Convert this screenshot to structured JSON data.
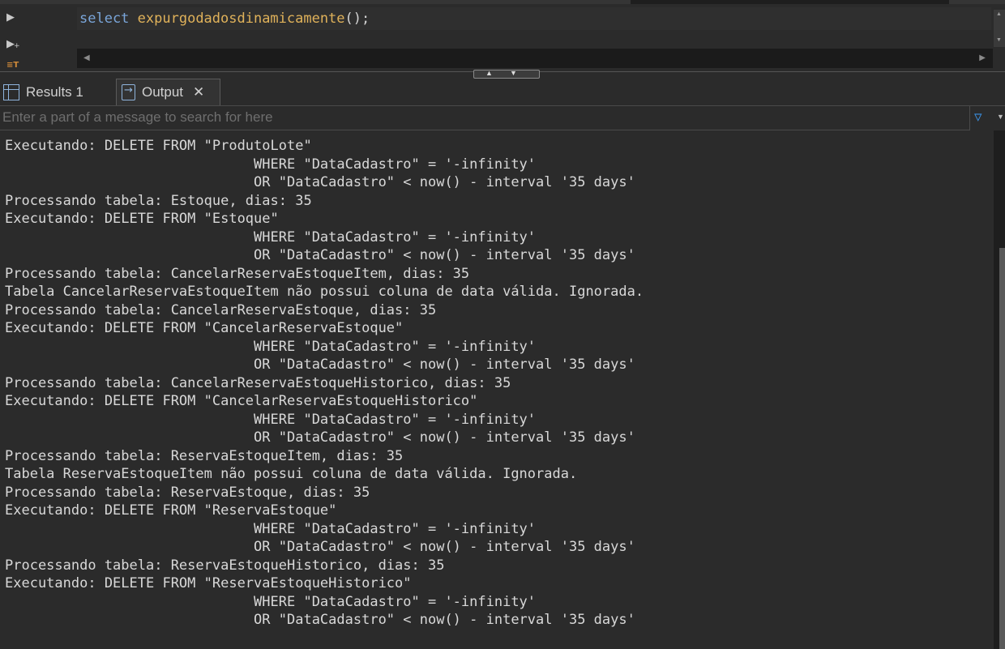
{
  "editor": {
    "code": {
      "keyword": "select",
      "function": "expurgodadosdinamicamente",
      "punct": "();"
    },
    "icons": {
      "run": "play-icon",
      "run_all": "run-script-icon",
      "explain": "explain-plan-icon"
    }
  },
  "tabs": [
    {
      "label": "Results 1",
      "icon": "grid-icon"
    },
    {
      "label": "Output",
      "icon": "output-icon"
    }
  ],
  "search": {
    "placeholder": "Enter a part of a message to search for here",
    "value": ""
  },
  "output": {
    "lines": [
      "Executando: DELETE FROM \"ProdutoLote\"",
      "                              WHERE \"DataCadastro\" = '-infinity'",
      "                              OR \"DataCadastro\" < now() - interval '35 days'",
      "Processando tabela: Estoque, dias: 35",
      "Executando: DELETE FROM \"Estoque\"",
      "                              WHERE \"DataCadastro\" = '-infinity'",
      "                              OR \"DataCadastro\" < now() - interval '35 days'",
      "Processando tabela: CancelarReservaEstoqueItem, dias: 35",
      "Tabela CancelarReservaEstoqueItem não possui coluna de data válida. Ignorada.",
      "Processando tabela: CancelarReservaEstoque, dias: 35",
      "Executando: DELETE FROM \"CancelarReservaEstoque\"",
      "                              WHERE \"DataCadastro\" = '-infinity'",
      "                              OR \"DataCadastro\" < now() - interval '35 days'",
      "Processando tabela: CancelarReservaEstoqueHistorico, dias: 35",
      "Executando: DELETE FROM \"CancelarReservaEstoqueHistorico\"",
      "                              WHERE \"DataCadastro\" = '-infinity'",
      "                              OR \"DataCadastro\" < now() - interval '35 days'",
      "Processando tabela: ReservaEstoqueItem, dias: 35",
      "Tabela ReservaEstoqueItem não possui coluna de data válida. Ignorada.",
      "Processando tabela: ReservaEstoque, dias: 35",
      "Executando: DELETE FROM \"ReservaEstoque\"",
      "                              WHERE \"DataCadastro\" = '-infinity'",
      "                              OR \"DataCadastro\" < now() - interval '35 days'",
      "Processando tabela: ReservaEstoqueHistorico, dias: 35",
      "Executando: DELETE FROM \"ReservaEstoqueHistorico\"",
      "                              WHERE \"DataCadastro\" = '-infinity'",
      "                              OR \"DataCadastro\" < now() - interval '35 days'"
    ]
  },
  "colors": {
    "background": "#2b2b2b",
    "keyword": "#7aa6da",
    "function": "#e0b25a",
    "filter_icon": "#3a8fe0"
  }
}
